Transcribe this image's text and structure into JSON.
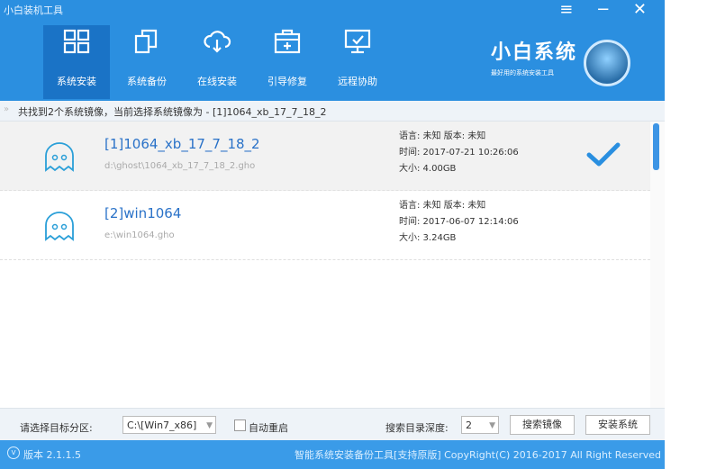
{
  "window": {
    "title": "小白装机工具",
    "controls": [
      "≡",
      "−",
      "✕"
    ]
  },
  "nav": {
    "items": [
      {
        "label": "系统安装",
        "icon": "windows-grid-icon",
        "active": true
      },
      {
        "label": "系统备份",
        "icon": "copy-icon",
        "active": false
      },
      {
        "label": "在线安装",
        "icon": "cloud-download-icon",
        "active": false
      },
      {
        "label": "引导修复",
        "icon": "toolbox-icon",
        "active": false
      },
      {
        "label": "远程协助",
        "icon": "remote-monitor-icon",
        "active": false
      }
    ]
  },
  "brand": {
    "name": "小白系统",
    "tagline": "最好用的系统安装工具"
  },
  "info": {
    "text": "共找到2个系统镜像，当前选择系统镜像为 - [1]1064_xb_17_7_18_2"
  },
  "images": [
    {
      "name": "[1]1064_xb_17_7_18_2",
      "path": "d:\\ghost\\1064_xb_17_7_18_2.gho",
      "lang_ver": "语言: 未知    版本: 未知",
      "time": "时间: 2017-07-21 10:26:06",
      "size": "大小: 4.00GB",
      "selected": true
    },
    {
      "name": "[2]win1064",
      "path": "e:\\win1064.gho",
      "lang_ver": "语言: 未知    版本: 未知",
      "time": "时间: 2017-06-07 12:14:06",
      "size": "大小: 3.24GB",
      "selected": false
    }
  ],
  "bottom": {
    "partition_label": "请选择目标分区:",
    "partition_value": "C:\\[Win7_x86]",
    "auto_restart_label": "自动重启",
    "depth_label": "搜索目录深度:",
    "depth_value": "2",
    "search_button": "搜索镜像",
    "install_button": "安装系统"
  },
  "footer": {
    "version": "版本 2.1.1.5",
    "copyright": "智能系统安装备份工具[支持原版]  CopyRight(C) 2016-2017 All Right Reserved"
  },
  "colors": {
    "header": "#2b8fe0",
    "nav_active": "#1a73c6",
    "footer": "#3a9be8",
    "accent": "#2a72c8"
  }
}
